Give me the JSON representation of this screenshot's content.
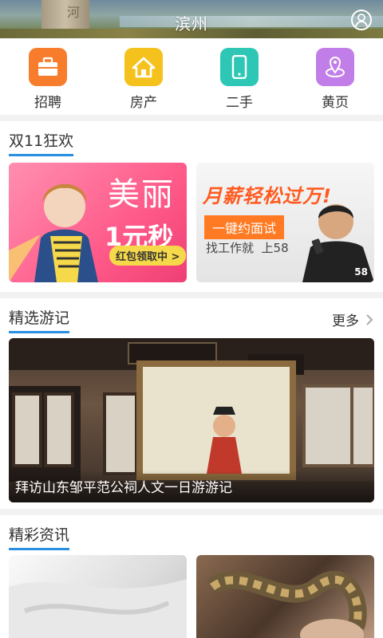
{
  "header": {
    "title": "滨州",
    "stone_text": "河"
  },
  "nav": [
    {
      "label": "招聘",
      "icon": "briefcase-icon",
      "color": "#f77d2c"
    },
    {
      "label": "房产",
      "icon": "house-icon",
      "color": "#f5c21d"
    },
    {
      "label": "二手",
      "icon": "phone-icon",
      "color": "#2ec7b5"
    },
    {
      "label": "黄页",
      "icon": "location-icon",
      "color": "#c27ee8"
    }
  ],
  "promo": {
    "title": "双11狂欢",
    "left": {
      "line1": "美丽",
      "line2": "1元秒",
      "badge": "红包领取中 >"
    },
    "right": {
      "headline": "月薪轻松过万!",
      "pill": "一键约面试",
      "sub": "找工作就  上58",
      "corner": "58"
    }
  },
  "travel": {
    "title": "精选游记",
    "more": "更多",
    "caption": "拜访山东邹平范公祠人文一日游游记"
  },
  "news": {
    "title": "精彩资讯"
  },
  "colors": {
    "accent": "#2a8fe0"
  }
}
